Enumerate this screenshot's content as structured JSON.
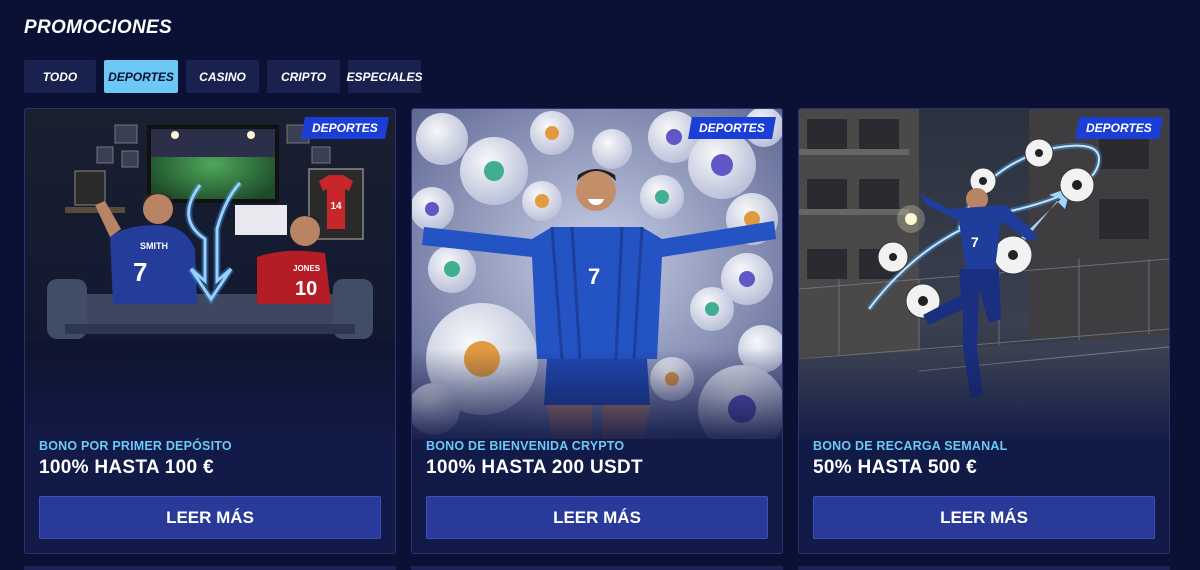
{
  "header": {
    "title": "PROMOCIONES"
  },
  "tabs": [
    {
      "label": "TODO",
      "active": false
    },
    {
      "label": "DEPORTES",
      "active": true
    },
    {
      "label": "CASINO",
      "active": false
    },
    {
      "label": "CRIPTO",
      "active": false
    },
    {
      "label": "ESPECIALES",
      "active": false
    }
  ],
  "cards": [
    {
      "badge": "DEPORTES",
      "subtitle": "BONO POR PRIMER DEPÓSITO",
      "offer": "100% HASTA 100 €",
      "button": "LEER MÁS",
      "image": "two-fans-watching-football-on-couch",
      "jersey_left_name": "SMITH",
      "jersey_left_number": "7",
      "jersey_right_name": "JONES",
      "jersey_right_number": "10",
      "wall_jersey_number": "14"
    },
    {
      "badge": "DEPORTES",
      "subtitle": "BONO DE BIENVENIDA CRYPTO",
      "offer": "100% HASTA 200 USDT",
      "button": "LEER MÁS",
      "image": "player-among-crypto-footballs",
      "jersey_number": "7"
    },
    {
      "badge": "DEPORTES",
      "subtitle": "BONO DE RECARGA SEMANAL",
      "offer": "50% HASTA 500 €",
      "button": "LEER MÁS",
      "image": "player-kicking-balls-street-court",
      "jersey_number": "7"
    }
  ],
  "colors": {
    "background": "#0b1035",
    "tab": "#19224f",
    "tab_active": "#6cc8f4",
    "badge": "#1b3fd6",
    "subtitle": "#6cc8f4",
    "button": "#2a3a9a"
  }
}
